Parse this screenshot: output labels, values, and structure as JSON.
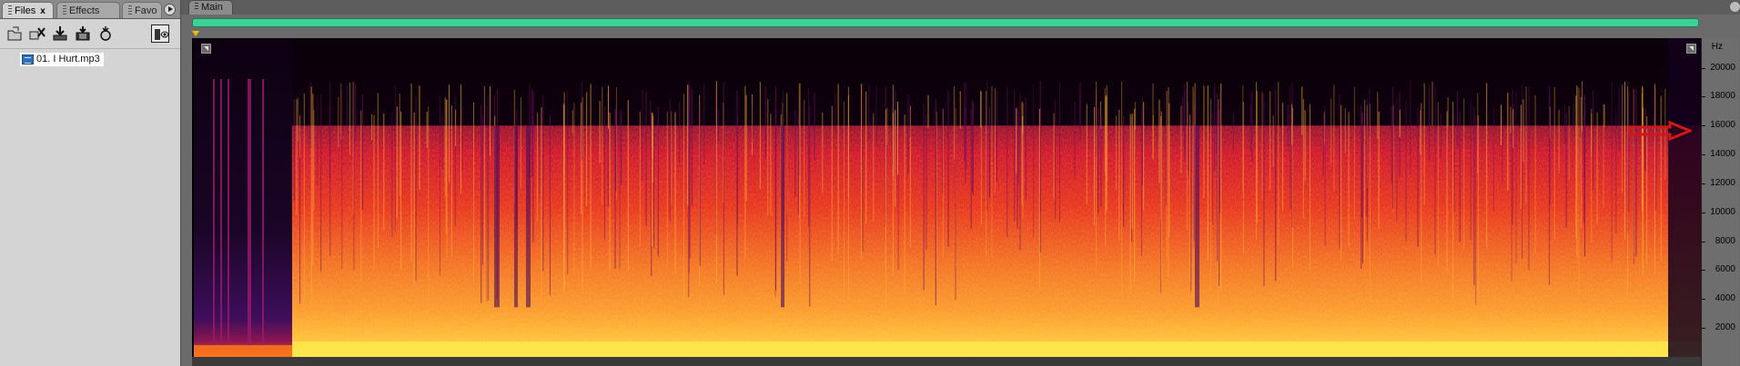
{
  "left_panel": {
    "tabs": [
      {
        "label": "Files",
        "close": "x",
        "active": true
      },
      {
        "label": "Effects",
        "active": false
      },
      {
        "label": "Favo",
        "active": false
      }
    ],
    "toolbar": {
      "icons": [
        "open-file-icon",
        "close-file-icon",
        "import-icon",
        "insert-into-multitrack-icon",
        "autoplay-icon",
        "show-full-paths-icon"
      ]
    },
    "files": [
      {
        "name": "01. I Hurt.mp3",
        "icon": "audio-file-icon",
        "selected": true
      }
    ]
  },
  "main_panel": {
    "tab_label": "Main",
    "overview_color": "#3fd095",
    "frequency_scale": {
      "unit": "Hz",
      "ticks": [
        "20000",
        "18000",
        "16000",
        "14000",
        "12000",
        "10000",
        "8000",
        "6000",
        "4000",
        "2000"
      ],
      "max_hz": 22050
    },
    "spectral_view": {
      "cutoff_hz": 16000,
      "annotation": "red-arrow-pointing-at-16000",
      "palette": [
        "#0a0008",
        "#3a0a4a",
        "#7a0a6a",
        "#c8102a",
        "#f24a14",
        "#ff9a2a",
        "#ffe24a"
      ]
    }
  }
}
